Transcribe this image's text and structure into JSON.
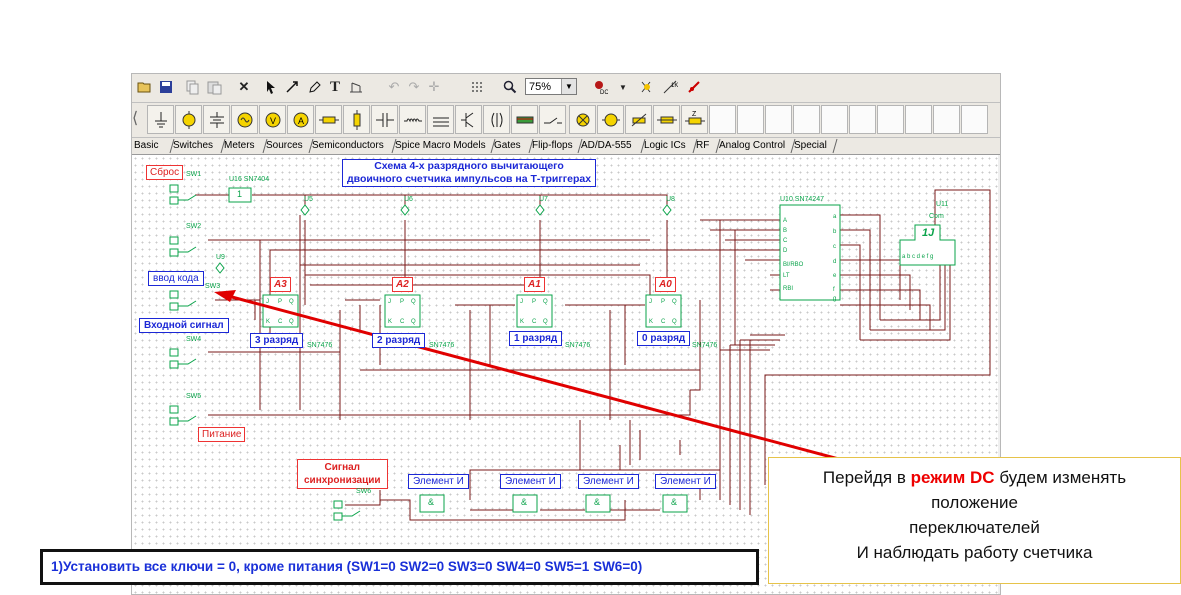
{
  "toolbar": {
    "zoom_value": "75%",
    "icons": [
      "open-icon",
      "save-icon",
      "copy-icon",
      "paste-icon",
      "delete-icon",
      "pointer-icon",
      "wire-icon",
      "pen-icon",
      "text-icon",
      "annotation-icon",
      "undo-icon",
      "redo-icon",
      "move-icon",
      "grid-icon",
      "zoom-icon",
      "zoom-dropdown",
      "probe-dc-icon",
      "dropdown",
      "run-icon",
      "step-icon",
      "stop-icon"
    ]
  },
  "components_bar": {
    "icons": [
      "ground",
      "battery",
      "dc-source",
      "ac-source",
      "voltmeter",
      "ammeter",
      "resistor",
      "diode",
      "capacitor",
      "inductor",
      "transformer",
      "transistor",
      "op-amp",
      "switch",
      "lamp",
      "motor",
      "potentiometer",
      "fuse",
      "resistor-z"
    ]
  },
  "tabs": [
    "Basic",
    "Switches",
    "Meters",
    "Sources",
    "Semiconductors",
    "Spice Macro Models",
    "Gates",
    "Flip-flops",
    "AD/DA-555",
    "Logic ICs",
    "RF",
    "Analog Control",
    "Special"
  ],
  "schematic": {
    "title_line1": "Схема 4-х разрядного вычитающего",
    "title_line2": "двоичного счетчика импульсов на Т-триггерах",
    "reset_label": "Сброс",
    "code_input_label": "ввод кода",
    "input_signal_label": "Входной сигнал",
    "power_label": "Питание",
    "sync_label_1": "Сигнал",
    "sync_label_2": "синхронизации",
    "switch_labels": [
      "SW1",
      "SW2",
      "SW3",
      "SW4",
      "SW5",
      "SW6"
    ],
    "ic_inverter": "U16 SN7404",
    "ic_decoder": "U10 SN74247",
    "display_label": "U11",
    "display_com": "Com",
    "display_pins": "a b c d e f g",
    "display_value": "1J",
    "probes": [
      "U5",
      "U6",
      "U7",
      "U8",
      "U9"
    ],
    "inverter_value": "1",
    "flipflops": [
      {
        "tag": "A3",
        "digit": "3 разряд",
        "part": "SN7476"
      },
      {
        "tag": "A2",
        "digit": "2 разряд",
        "part": "SN7476"
      },
      {
        "tag": "A1",
        "digit": "1 разряд",
        "part": "SN7476"
      },
      {
        "tag": "A0",
        "digit": "0 разряд",
        "part": "SN7476"
      }
    ],
    "and_gates": [
      "Элемент И",
      "Элемент И",
      "Элемент И",
      "Элемент И"
    ],
    "and_gate_symbol": "&",
    "decoder_pins_left": [
      "A",
      "B",
      "C",
      "D",
      "BI/RBO",
      "LT",
      "RBI"
    ],
    "decoder_pins_right": [
      "a",
      "b",
      "c",
      "d",
      "e",
      "f",
      "g"
    ]
  },
  "instruction_text": "1)Установить все ключи = 0, кроме питания (SW1=0 SW2=0 SW3=0 SW4=0 SW5=1 SW6=0)",
  "note": {
    "line1_prefix": "Перейдя в ",
    "line1_emph": "режим DC",
    "line1_suffix": " будем изменять",
    "line2": "положение",
    "line3": "переключателей",
    "line4": "И наблюдать работу счетчика"
  },
  "colors": {
    "wire": "#7a1818",
    "component": "#0aa34a",
    "label_blue": "#1c28d6",
    "label_red": "#e33333",
    "arrow": "#e00000"
  }
}
